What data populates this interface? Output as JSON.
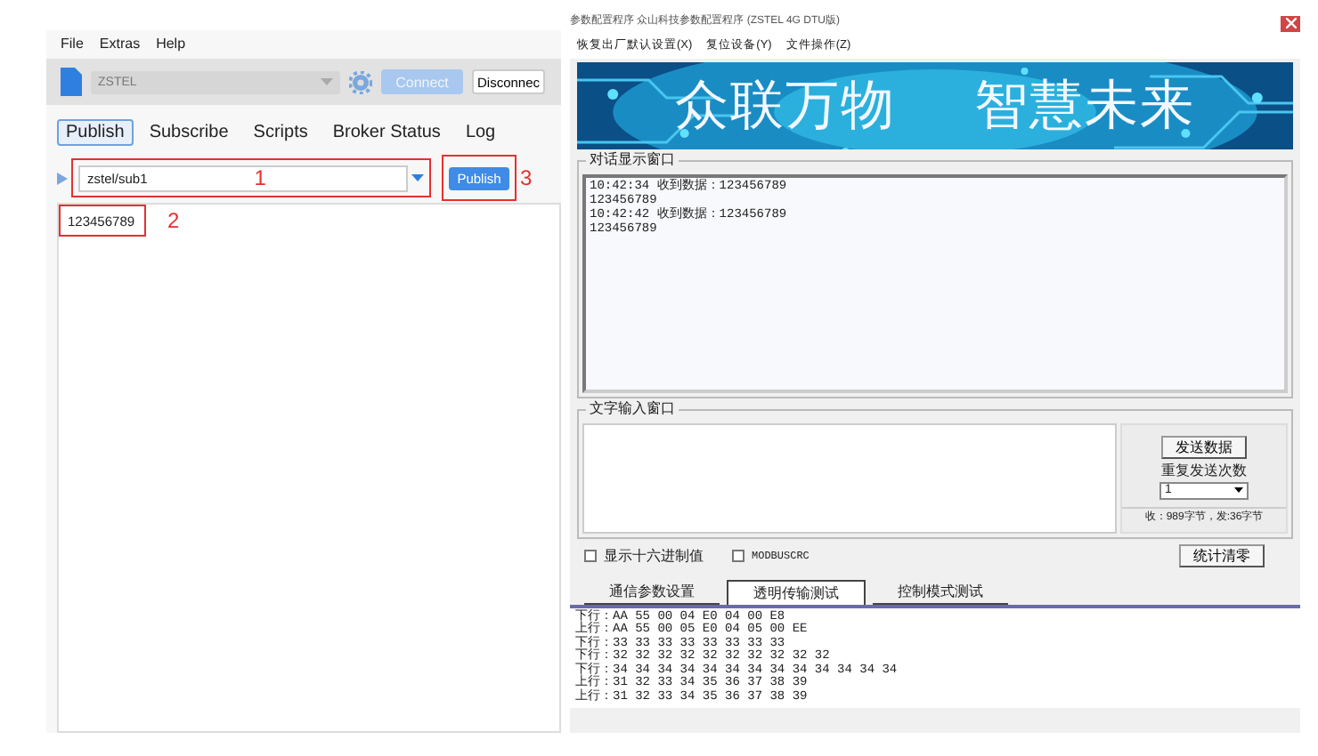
{
  "mqtt_client": {
    "menu": [
      "File",
      "Extras",
      "Help"
    ],
    "toolbar": {
      "profile": "ZSTEL",
      "connect": "Connect",
      "disconnect": "Disconnec"
    },
    "tabs": [
      {
        "label": "Publish",
        "selected": true
      },
      {
        "label": "Subscribe",
        "selected": false
      },
      {
        "label": "Scripts",
        "selected": false
      },
      {
        "label": "Broker Status",
        "selected": false
      },
      {
        "label": "Log",
        "selected": false
      }
    ],
    "topic": "zstel/sub1",
    "publish_button": "Publish",
    "messages": [
      "123456789"
    ],
    "annotations": {
      "topic": "1",
      "message": "2",
      "publish": "3"
    }
  },
  "config_tool": {
    "window": {
      "title": "参数配置程序 众山科技参数配置程序 (ZSTEL 4G DTU版)"
    },
    "menu": [
      "恢复出厂默认设置(X)",
      "复位设备(Y)",
      "文件操作(Z)"
    ],
    "banner": [
      "众联万物",
      "智慧未来"
    ],
    "dialog": {
      "legend": "对话显示窗口",
      "lines": [
        "10:42:34 收到数据：123456789",
        "123456789",
        "10:42:42 收到数据：123456789",
        "123456789"
      ]
    },
    "input": {
      "legend": "文字输入窗口",
      "send_button": "发送数据",
      "repeat_label": "重复发送次数",
      "repeat_value": "1",
      "stats": "收：989字节，发:36字节"
    },
    "options": [
      {
        "label": "显示十六进制值",
        "checked": false
      },
      {
        "label": "MODBUSCRC",
        "checked": false
      }
    ],
    "clear_button": "统计清零",
    "tabs": [
      {
        "label": "通信参数设置",
        "selected": false
      },
      {
        "label": "透明传输测试",
        "selected": true
      },
      {
        "label": "控制模式测试",
        "selected": false
      }
    ],
    "log": [
      "下行：AA 55 00 04 E0 04 00 E8",
      "上行：AA 55 00 05 E0 04 05 00 EE",
      "下行：33 33 33 33 33 33 33 33",
      "下行：32 32 32 32 32 32 32 32 32 32",
      "下行：34 34 34 34 34 34 34 34 34 34 34 34 34",
      "上行：31 32 33 34 35 36 37 38 39",
      "上行：31 32 33 34 35 36 37 38 39"
    ]
  }
}
